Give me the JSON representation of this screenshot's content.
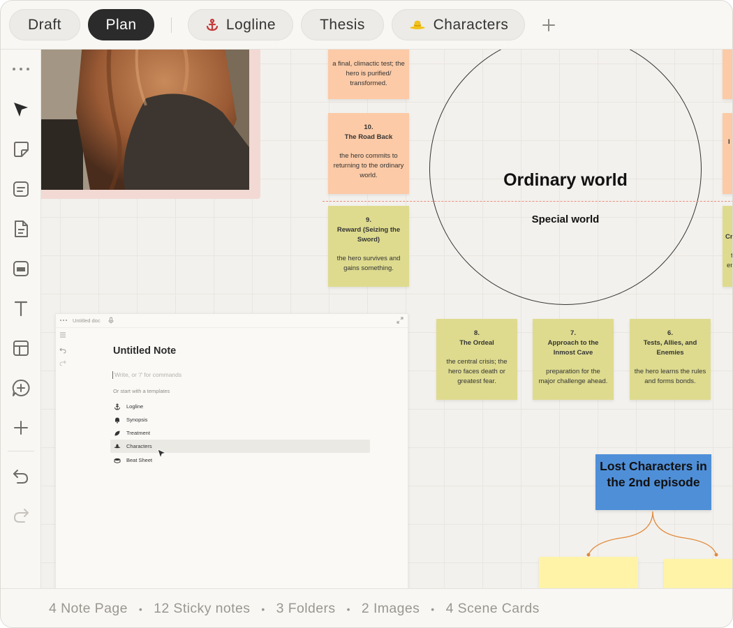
{
  "tabs": [
    {
      "label": "Draft",
      "icon": null
    },
    {
      "label": "Plan",
      "icon": null,
      "active": true
    },
    {
      "label": "Logline",
      "icon": "anchor-icon"
    },
    {
      "label": "Thesis",
      "icon": null
    },
    {
      "label": "Characters",
      "icon": "hat-icon"
    }
  ],
  "toolbar": [
    "more-icon",
    "select-arrow-icon",
    "sticky-note-icon",
    "card-icon",
    "document-icon",
    "scene-card-icon",
    "text-icon",
    "layout-icon",
    "comment-add-icon",
    "add-icon",
    "undo-icon",
    "redo-icon"
  ],
  "canvas": {
    "stickies": [
      {
        "id": "s11",
        "num": "",
        "title": "",
        "desc": "a final, climactic test; the hero is purified/ transformed.",
        "color": "orange"
      },
      {
        "id": "s10",
        "num": "10.",
        "title": "The Road Back",
        "desc": "the hero commits to returning to the ordinary world.",
        "color": "orange"
      },
      {
        "id": "s9",
        "num": "9.",
        "title": "Reward (Seizing the Sword)",
        "desc": "the hero survives and gains something.",
        "color": "olive"
      },
      {
        "id": "s8",
        "num": "8.",
        "title": "The Ordeal",
        "desc": "the central crisis; the hero faces death or greatest fear.",
        "color": "olive"
      },
      {
        "id": "s7",
        "num": "7.",
        "title": "Approach to the Inmost Cave",
        "desc": "preparation for the major challenge ahead.",
        "color": "olive"
      },
      {
        "id": "s6",
        "num": "6.",
        "title": "Tests, Allies, and Enemies",
        "desc": "the hero learns the rules and forms bonds.",
        "color": "olive"
      }
    ],
    "edge_partial": [
      "I",
      "Cr",
      "t",
      "en"
    ],
    "circle": {
      "top_label": "Ordinary world",
      "bottom_label": "Special world"
    },
    "blue_card": "Lost Characters in the 2nd episode",
    "colors": {
      "orange": "#fccaa6",
      "olive": "#dedb8f",
      "yellow": "#fff3a8",
      "blue": "#4f8fd8",
      "dash": "#e98b7d",
      "connector": "#e08a3c"
    }
  },
  "doc": {
    "header_title": "Untitled doc",
    "title": "Untitled Note",
    "placeholder": "Write, or '/' for commands",
    "hint": "Or start with a templates",
    "templates": [
      {
        "label": "Logline",
        "icon": "anchor-icon"
      },
      {
        "label": "Synopsis",
        "icon": "bell-icon"
      },
      {
        "label": "Treatment",
        "icon": "leaf-icon"
      },
      {
        "label": "Characters",
        "icon": "hat-icon",
        "highlighted": true
      },
      {
        "label": "Beat Sheet",
        "icon": "drum-icon"
      }
    ]
  },
  "status": [
    "4 Note Page",
    "12 Sticky notes",
    "3 Folders",
    "2 Images",
    "4 Scene Cards"
  ]
}
